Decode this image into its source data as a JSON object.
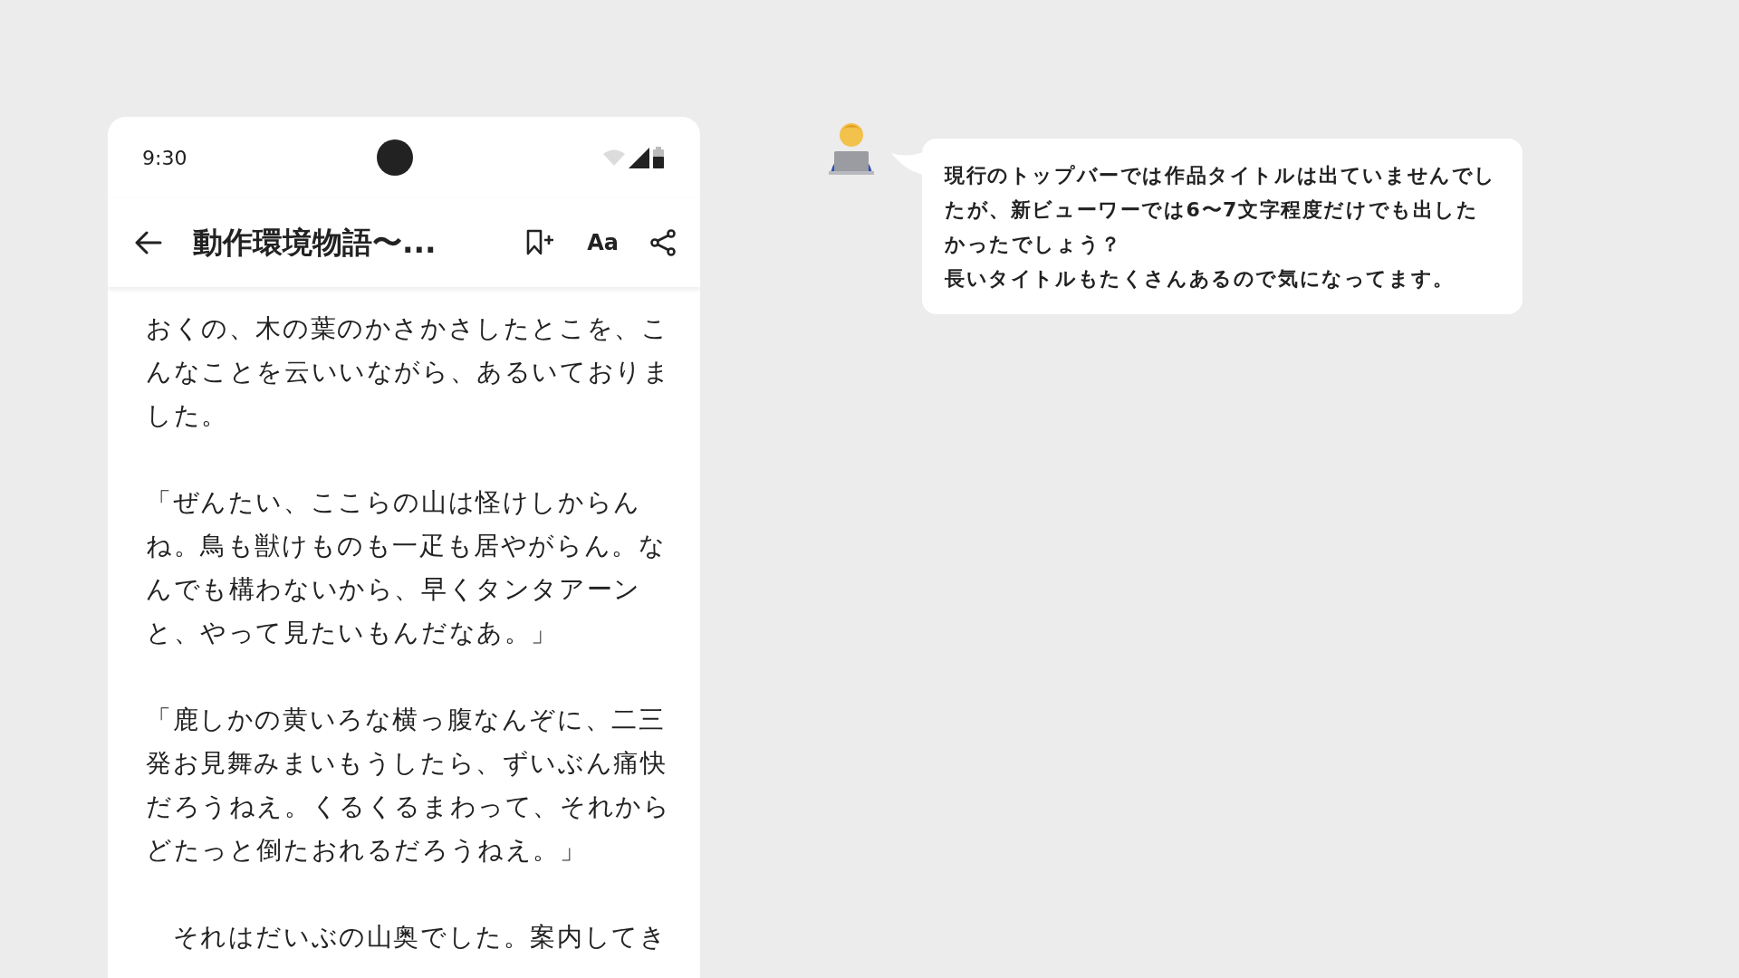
{
  "status_bar": {
    "time": "9:30"
  },
  "app_bar": {
    "title": "動作環境物語〜...",
    "font_button": "Aa"
  },
  "paragraphs": [
    {
      "text": "おくの、木の葉のかさかさしたとこを、こんなことを云いいながら、あるいておりました。"
    },
    {
      "text": "「ぜんたい、ここらの山は怪けしからんね。鳥も獣けものも一疋も居やがらん。なんでも構わないから、早くタンタアーンと、やって見たいもんだなあ。」"
    },
    {
      "text": "「鹿しかの黄いろな横っ腹なんぞに、二三発お見舞みまいもうしたら、ずいぶん痛快だろうねえ。くるくるまわって、それからどたっと倒たおれるだろうねえ。」"
    },
    {
      "text": "　それはだいぶの山奥でした。案内してき"
    }
  ],
  "comment": {
    "paragraphs": [
      {
        "text": "現行のトップバーでは作品タイトルは出ていませんでしたが、新ビューワーでは6〜7文字程度だけでも出したかったでしょう？"
      },
      {
        "text": "長いタイトルもたくさんあるので気になってます。"
      }
    ]
  }
}
